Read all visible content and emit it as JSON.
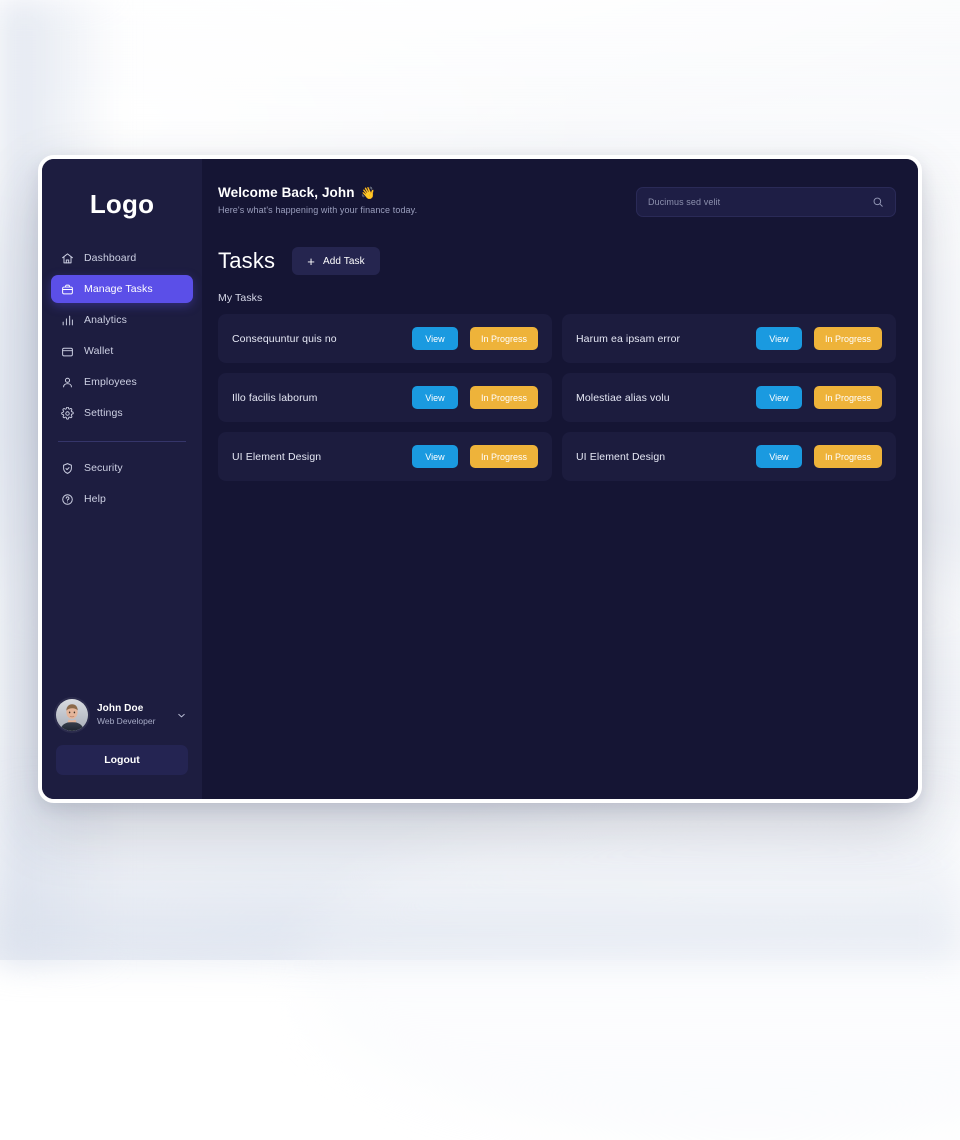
{
  "sidebar": {
    "logo": "Logo",
    "items": [
      {
        "label": "Dashboard",
        "icon": "home-icon",
        "active": false
      },
      {
        "label": "Manage Tasks",
        "icon": "briefcase-icon",
        "active": true
      },
      {
        "label": "Analytics",
        "icon": "bar-chart-icon",
        "active": false
      },
      {
        "label": "Wallet",
        "icon": "wallet-icon",
        "active": false
      },
      {
        "label": "Employees",
        "icon": "user-icon",
        "active": false
      },
      {
        "label": "Settings",
        "icon": "gear-icon",
        "active": false
      }
    ],
    "secondary_items": [
      {
        "label": "Security",
        "icon": "shield-check-icon"
      },
      {
        "label": "Help",
        "icon": "question-circle-icon"
      }
    ],
    "profile": {
      "name": "John Doe",
      "role": "Web Developer",
      "avatar": "user-photo-avatar",
      "chevron": "chevron-down-icon"
    },
    "logout_label": "Logout"
  },
  "header": {
    "welcome_title": "Welcome Back, John",
    "welcome_emoji": "👋",
    "welcome_subtitle": "Here's what's happening with your finance today.",
    "search": {
      "placeholder": "Ducimus sed velit",
      "value": "",
      "icon": "search-icon"
    }
  },
  "main": {
    "section_title": "Tasks",
    "add_task_label": "Add Task",
    "add_task_icon": "plus-icon",
    "my_tasks_label": "My Tasks",
    "tasks": [
      {
        "name": "Consequuntur quis no",
        "view_label": "View",
        "status_label": "In Progress"
      },
      {
        "name": "Harum ea ipsam error",
        "view_label": "View",
        "status_label": "In Progress"
      },
      {
        "name": "Illo facilis laborum",
        "view_label": "View",
        "status_label": "In Progress"
      },
      {
        "name": "Molestiae alias volu",
        "view_label": "View",
        "status_label": "In Progress"
      },
      {
        "name": "UI Element Design",
        "view_label": "View",
        "status_label": "In Progress"
      },
      {
        "name": "UI Element Design",
        "view_label": "View",
        "status_label": "In Progress"
      }
    ]
  },
  "colors": {
    "sidebar_bg": "#1d1d40",
    "main_bg": "#151534",
    "card_bg": "#1c1c3e",
    "accent_purple": "#5b4fe8",
    "view_blue": "#1a9ae0",
    "status_amber": "#eeb33a"
  }
}
